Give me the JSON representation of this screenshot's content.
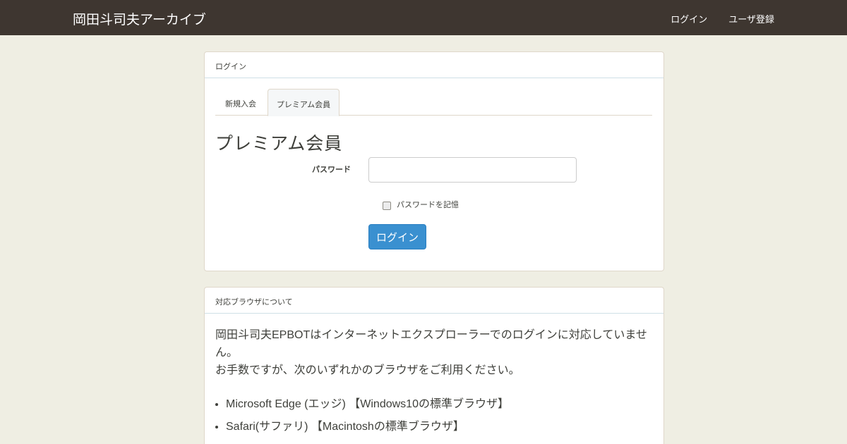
{
  "navbar": {
    "brand": "岡田斗司夫アーカイブ",
    "links": [
      "ログイン",
      "ユーザ登録"
    ]
  },
  "login_panel": {
    "heading": "ログイン",
    "tabs": [
      "新規入会",
      "プレミアム会員"
    ],
    "active_tab": "プレミアム会員",
    "form_title": "プレミアム会員",
    "password_label": "パスワード",
    "password_value": "",
    "remember_label": "パスワードを記憶",
    "remember_checked": false,
    "submit_label": "ログイン"
  },
  "browser_panel": {
    "heading": "対応ブラウザについて",
    "line1": "岡田斗司夫EPBOTはインターネットエクスプローラーでのログインに対応していません。",
    "line2": "お手数ですが、次のいずれかのブラウザをご利用ください。",
    "items": [
      "Microsoft Edge (エッジ) 【Windows10の標準ブラウザ】",
      "Safari(サファリ) 【Macintoshの標準ブラウザ】"
    ]
  },
  "colors": {
    "navbar": "#3e3630",
    "background": "#efeee3",
    "primary_button": "#3a90d0"
  }
}
